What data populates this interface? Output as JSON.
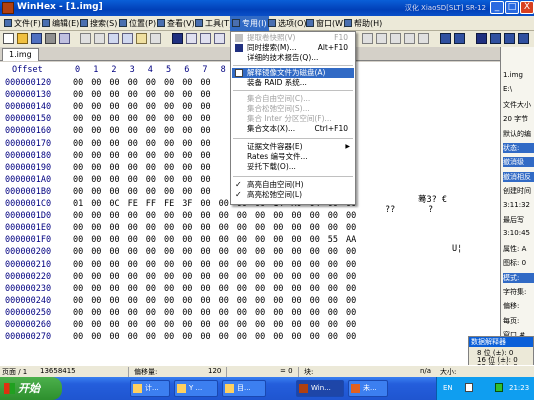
{
  "window": {
    "title": "WinHex - [1.img]",
    "right_text": "汉化 XiaoSD[SLT] SR-12",
    "buttons": [
      "_",
      "□",
      "X"
    ]
  },
  "menubar": [
    "文件(F)",
    "编辑(E)",
    "搜索(S)",
    "位置(P)",
    "查看(V)",
    "工具(T)",
    "专用(I)",
    "选项(O)",
    "窗口(W)",
    "帮助(H)"
  ],
  "tab": "1.img",
  "hex": {
    "header_offset": "Offset",
    "columns": [
      "0",
      "1",
      "2",
      "3",
      "4",
      "5",
      "6",
      "7",
      "8",
      "9",
      "A",
      "B",
      "C",
      "D",
      "E",
      "F"
    ],
    "rows": [
      {
        "off": "000000120",
        "b": [
          "00",
          "00",
          "00",
          "00",
          "00",
          "00",
          "00",
          "00",
          "",
          "",
          "",
          "",
          "",
          "",
          "",
          ""
        ]
      },
      {
        "off": "000000130",
        "b": [
          "00",
          "00",
          "00",
          "00",
          "00",
          "00",
          "00",
          "00",
          "",
          "",
          "",
          "",
          "",
          "",
          "",
          ""
        ]
      },
      {
        "off": "000000140",
        "b": [
          "00",
          "00",
          "00",
          "00",
          "00",
          "00",
          "00",
          "00",
          "",
          "",
          "",
          "",
          "",
          "",
          "",
          ""
        ]
      },
      {
        "off": "000000150",
        "b": [
          "00",
          "00",
          "00",
          "00",
          "00",
          "00",
          "00",
          "00",
          "",
          "",
          "",
          "",
          "",
          "",
          "",
          ""
        ]
      },
      {
        "off": "000000160",
        "b": [
          "00",
          "00",
          "00",
          "00",
          "00",
          "00",
          "00",
          "00",
          "",
          "",
          "",
          "",
          "",
          "",
          "",
          ""
        ]
      },
      {
        "off": "000000170",
        "b": [
          "00",
          "00",
          "00",
          "00",
          "00",
          "00",
          "00",
          "00",
          "",
          "",
          "",
          "",
          "",
          "",
          "",
          ""
        ]
      },
      {
        "off": "000000180",
        "b": [
          "00",
          "00",
          "00",
          "00",
          "00",
          "00",
          "00",
          "00",
          "",
          "",
          "",
          "",
          "",
          "",
          "",
          ""
        ]
      },
      {
        "off": "000000190",
        "b": [
          "00",
          "00",
          "00",
          "00",
          "00",
          "00",
          "00",
          "00",
          "",
          "",
          "",
          "",
          "",
          "",
          "",
          ""
        ]
      },
      {
        "off": "0000001A0",
        "b": [
          "00",
          "00",
          "00",
          "00",
          "00",
          "00",
          "00",
          "00",
          "",
          "",
          "",
          "",
          "",
          "",
          "",
          ""
        ]
      },
      {
        "off": "0000001B0",
        "b": [
          "00",
          "00",
          "00",
          "00",
          "00",
          "00",
          "00",
          "00",
          "",
          "",
          "",
          "",
          "",
          "",
          "",
          ""
        ]
      },
      {
        "off": "0000001C0",
        "b": [
          "01",
          "00",
          "0C",
          "FE",
          "FF",
          "FE",
          "3F",
          "00",
          "00",
          "00",
          "00",
          "14",
          "A0",
          "04",
          "00",
          "00"
        ]
      },
      {
        "off": "0000001D0",
        "b": [
          "00",
          "00",
          "00",
          "00",
          "00",
          "00",
          "00",
          "00",
          "00",
          "00",
          "00",
          "00",
          "00",
          "00",
          "00",
          "00"
        ]
      },
      {
        "off": "0000001E0",
        "b": [
          "00",
          "00",
          "00",
          "00",
          "00",
          "00",
          "00",
          "00",
          "00",
          "00",
          "00",
          "00",
          "00",
          "00",
          "00",
          "00"
        ]
      },
      {
        "off": "0000001F0",
        "b": [
          "00",
          "00",
          "00",
          "00",
          "00",
          "00",
          "00",
          "00",
          "00",
          "00",
          "00",
          "00",
          "00",
          "00",
          "55",
          "AA"
        ]
      },
      {
        "off": "000000200",
        "b": [
          "00",
          "00",
          "00",
          "00",
          "00",
          "00",
          "00",
          "00",
          "00",
          "00",
          "00",
          "00",
          "00",
          "00",
          "00",
          "00"
        ]
      },
      {
        "off": "000000210",
        "b": [
          "00",
          "00",
          "00",
          "00",
          "00",
          "00",
          "00",
          "00",
          "00",
          "00",
          "00",
          "00",
          "00",
          "00",
          "00",
          "00"
        ]
      },
      {
        "off": "000000220",
        "b": [
          "00",
          "00",
          "00",
          "00",
          "00",
          "00",
          "00",
          "00",
          "00",
          "00",
          "00",
          "00",
          "00",
          "00",
          "00",
          "00"
        ]
      },
      {
        "off": "000000230",
        "b": [
          "00",
          "00",
          "00",
          "00",
          "00",
          "00",
          "00",
          "00",
          "00",
          "00",
          "00",
          "00",
          "00",
          "00",
          "00",
          "00"
        ]
      },
      {
        "off": "000000240",
        "b": [
          "00",
          "00",
          "00",
          "00",
          "00",
          "00",
          "00",
          "00",
          "00",
          "00",
          "00",
          "00",
          "00",
          "00",
          "00",
          "00"
        ]
      },
      {
        "off": "000000250",
        "b": [
          "00",
          "00",
          "00",
          "00",
          "00",
          "00",
          "00",
          "00",
          "00",
          "00",
          "00",
          "00",
          "00",
          "00",
          "00",
          "00"
        ]
      },
      {
        "off": "000000260",
        "b": [
          "00",
          "00",
          "00",
          "00",
          "00",
          "00",
          "00",
          "00",
          "00",
          "00",
          "00",
          "00",
          "00",
          "00",
          "00",
          "00"
        ]
      },
      {
        "off": "000000270",
        "b": [
          "00",
          "00",
          "00",
          "00",
          "00",
          "00",
          "00",
          "00",
          "00",
          "00",
          "00",
          "00",
          "00",
          "00",
          "00",
          "00"
        ]
      }
    ],
    "ascii_1B0": "蓦3? €",
    "ascii_1C0_a": "??",
    "ascii_1C0_b": "?",
    "ascii_1F0": "U¦"
  },
  "dropdown": [
    {
      "label": "提取卷快照(V)",
      "shortcut": "F10",
      "disabled": true
    },
    {
      "label": "同时搜索(M)...",
      "shortcut": "Alt+F10",
      "disabled": false
    },
    {
      "label": "详细的技术报告(Q)...",
      "shortcut": "",
      "disabled": false
    },
    {
      "label": "解释镜像文件为磁盘(A)",
      "shortcut": "",
      "highlighted": true
    },
    {
      "label": "装备 RAID 系统...",
      "shortcut": "",
      "disabled": false
    },
    {
      "label": "集合自由空间(C)...",
      "shortcut": "",
      "disabled": true
    },
    {
      "label": "集合松弛空间(S)...",
      "shortcut": "",
      "disabled": true
    },
    {
      "label": "集合 Inter 分区空间(F)...",
      "shortcut": "",
      "disabled": true
    },
    {
      "label": "集合文本(X)...",
      "shortcut": "Ctrl+F10",
      "disabled": false
    },
    {
      "label": "证据文件容器(E)",
      "shortcut": "",
      "submenu": true
    },
    {
      "label": "Rates 编号文件...",
      "shortcut": ""
    },
    {
      "label": "妥托下载(O)...",
      "shortcut": ""
    },
    {
      "label": "高亮自由空间(H)",
      "shortcut": "",
      "checked": true
    },
    {
      "label": "高亮松弛空间(L)",
      "shortcut": "",
      "checked": true
    }
  ],
  "right_panel": [
    "1.img",
    "E:\\",
    "文件大小",
    "20 字节",
    "默认的编",
    "状态:",
    "撤消级",
    "撤消相反",
    "创建时间",
    "3:11:32",
    "最后写",
    "3:10:45",
    "属性: A",
    "图标: 0",
    "模式:",
    "字符集:",
    "偏移:",
    "每页:",
    "窗口 #",
    "窗口 #"
  ],
  "interpreter": {
    "title": "数据解释器",
    "rows": [
      "8 位 (±): 0",
      "16 位 (±): 0",
      "32 位 (±): 0"
    ]
  },
  "statusbar": {
    "page": "页面 / 1",
    "size": "13658415",
    "offset_label": "偏移量:",
    "offset_value": "120",
    "value_label": "= 0",
    "block_label": "块:",
    "na": "n/a",
    "size_label": "大小:"
  },
  "taskbar": {
    "start": "开始",
    "tasks": [
      "计...",
      "Y ...",
      "目...",
      "Win...",
      "未..."
    ],
    "lang": "EN",
    "clock": "21:23"
  }
}
